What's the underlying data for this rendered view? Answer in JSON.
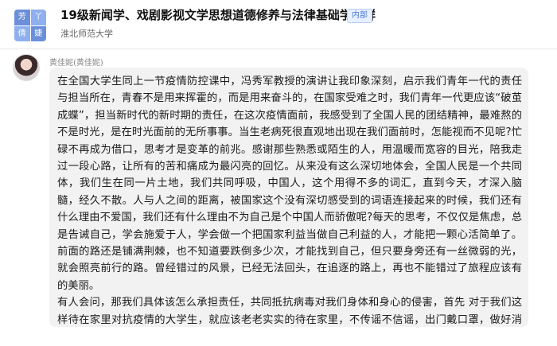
{
  "header": {
    "title": "19级新闻学、戏剧影视文学思想道德修养与法律基础学习群",
    "badge": "内部",
    "subtitle": "淮北师范大学",
    "avatar_chars": [
      "芳",
      "丫",
      "倩",
      "婕"
    ]
  },
  "message": {
    "sender": "黄佳妮(黄佳妮)",
    "paragraphs": [
      "在全国大学生同上一节疫情防控课中，冯秀军教授的演讲让我印象深刻，启示我们青年一代的责任与担当所在，青春不是用来挥霍的，而是用来奋斗的，在国家受难之时，我们青年一代更应该“破茧成蝶”，担当新时代的新时期的责任，在这次疫情面前，我感受到了全国人民的团结精神，最难熬的不是时光，是在时光面前的无所事事。当生老病死很直观地出现在我们面前时，怎能视而不见呢?忙碌不再成为借口，思考才是变革的前兆。感谢那些熟悉或陌生的人，用温暖而宽容的目光，陪我走过一段心路，让所有的苦和痛成为最闪亮的回忆。从来没有这么深切地体会，全国人民是一个共同体，我们生在同一片土地，我们共同呼吸，中国人，这个用得不多的词汇，直到今天，才深入脑髓，经久不散。人与人之间的距离，被国家这个没有深切感受到的词语连接起来的时候，我们还有什么理由不爱国，我们还有什么理由不为自己是个中国人而骄傲呢?每天的思考，不仅仅是焦虑，总是告诫自己，学会施爱于人，学会做一个把国家利益当做自己利益的人，才能把一颗心活简单了。前面的路还是铺满荆棘，也不知道要跌倒多少次，才能找到自己，但只要身旁还有一丝微弱的光，就会照亮前行的路。曾经错过的风景，已经无法回头，在追逐的路上，再也不能错过了旅程应该有的美丽。",
      "有人会问，那我们具体该怎么承担责任，共同抵抗病毒对我们身体和身心的侵害，首先 对于我们这样待在家里对抗疫情的大学生，就应该老老实实的待在家里，不传谣不信谣，出门戴口罩，做好消毒工作。第二，就是要倡导周围的人积极做好防护工作的同时，尽可能的支援一线。"
    ]
  },
  "colors": {
    "bubble": "#f2f2f2",
    "badge_text": "#4a78d6",
    "avatar_blue": "#6b8fd8"
  }
}
